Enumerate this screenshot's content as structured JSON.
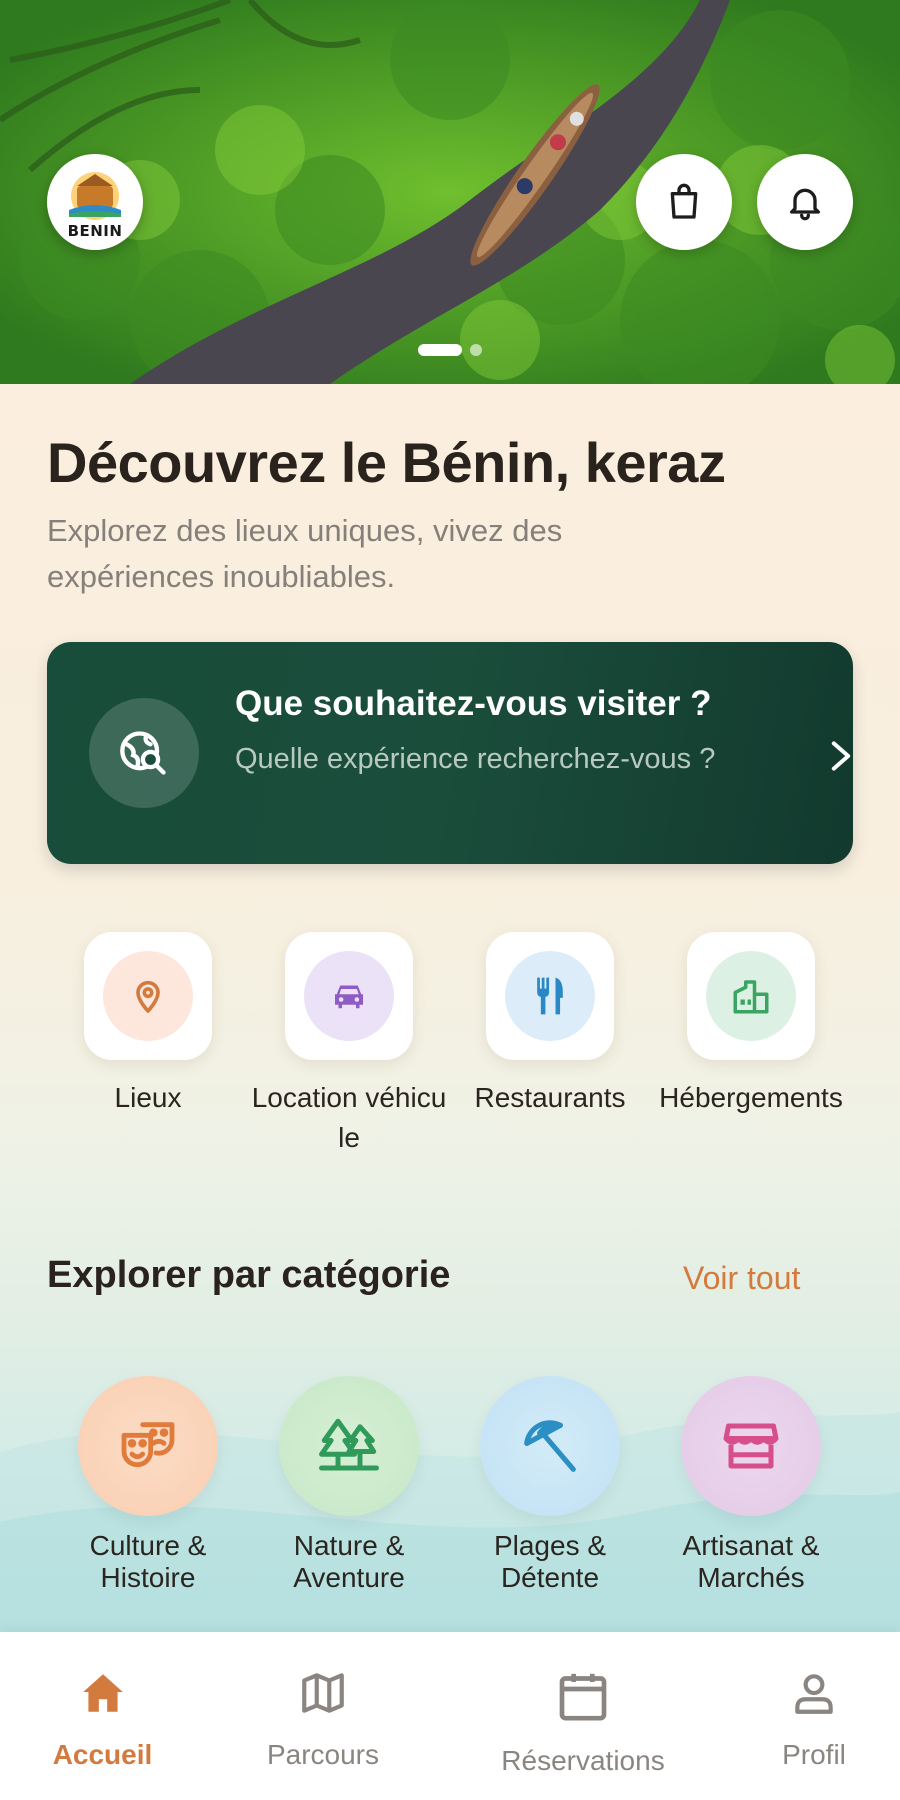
{
  "hero": {
    "logo_text": "BENIN",
    "slides_total": 2,
    "slide_active": 1
  },
  "main": {
    "headline": "Découvrez le Bénin, keraz",
    "subline": "Explorez des lieux uniques, vivez des expériences inoubliables."
  },
  "search_card": {
    "title": "Que souhaitez-vous visiter ?",
    "subtitle": "Quelle expérience recherchez-vous ?",
    "icon": "globe-search-icon"
  },
  "quick_actions": [
    {
      "label": "Lieux",
      "icon": "location-pin-icon",
      "color": "#d37a3e",
      "bg": "#fde7dc"
    },
    {
      "label": "Location véhicule",
      "icon": "car-icon",
      "color": "#8e5cc4",
      "bg": "#ece2f7"
    },
    {
      "label": "Restaurants",
      "icon": "fork-knife-icon",
      "color": "#2a89c4",
      "bg": "#dcedf9"
    },
    {
      "label": "Hébergements",
      "icon": "building-icon",
      "color": "#3aa462",
      "bg": "#dcf1e3"
    }
  ],
  "categories_section": {
    "title": "Explorer par catégorie",
    "see_all": "Voir tout"
  },
  "categories": [
    {
      "label_1": "Culture &",
      "label_2": "Histoire",
      "icon": "theater-masks-icon",
      "color": "#e07b3c",
      "bg": "#fbd8bf"
    },
    {
      "label_1": "Nature &",
      "label_2": "Aventure",
      "icon": "trees-icon",
      "color": "#2f9a5a",
      "bg": "#cfeccd"
    },
    {
      "label_1": "Plages &",
      "label_2": "Détente",
      "icon": "beach-umbrella-icon",
      "color": "#2b8fc4",
      "bg": "#c9e6f6"
    },
    {
      "label_1": "Artisanat &",
      "label_2": "Marchés",
      "icon": "storefront-icon",
      "color": "#d64e8a",
      "bg": "#ebd3ec"
    }
  ],
  "bottom_nav": [
    {
      "label": "Accueil",
      "icon": "home-icon",
      "active": true
    },
    {
      "label": "Parcours",
      "icon": "map-icon",
      "active": false
    },
    {
      "label": "Réservations",
      "icon": "calendar-icon",
      "active": false
    },
    {
      "label": "Profil",
      "icon": "person-icon",
      "active": false
    }
  ],
  "colors": {
    "accent": "#d37a3e",
    "card_dark_green": "#1b4d3b",
    "nav_inactive": "#8a8580"
  }
}
